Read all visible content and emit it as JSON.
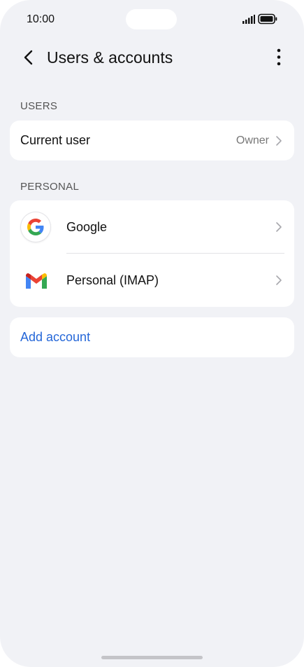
{
  "status_bar": {
    "time": "10:00"
  },
  "header": {
    "title": "Users & accounts"
  },
  "users_section": {
    "heading": "USERS",
    "current_user": {
      "label": "Current user",
      "value": "Owner"
    }
  },
  "personal_section": {
    "heading": "PERSONAL",
    "accounts": [
      {
        "label": "Google",
        "icon": "google-logo-icon"
      },
      {
        "label": "Personal (IMAP)",
        "icon": "gmail-logo-icon"
      }
    ]
  },
  "add_account": {
    "label": "Add account"
  },
  "colors": {
    "background": "#f1f2f6",
    "card": "#ffffff",
    "accent": "#2567d8"
  }
}
